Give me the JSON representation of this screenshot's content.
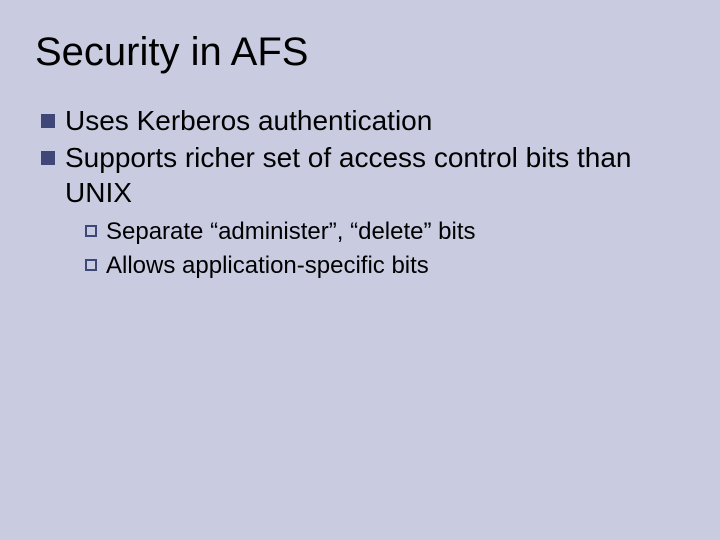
{
  "title": "Security in AFS",
  "bullets": [
    {
      "text": "Uses Kerberos authentication"
    },
    {
      "text": "Supports richer set of access control bits than UNIX",
      "sub": [
        {
          "text": "Separate “administer”, “delete” bits"
        },
        {
          "text": "Allows application-specific bits"
        }
      ]
    }
  ]
}
